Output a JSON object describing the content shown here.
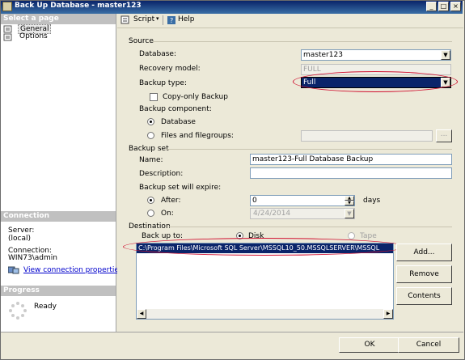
{
  "window": {
    "title": "Back Up Database - master123"
  },
  "sidebar": {
    "select_page_header": "Select a page",
    "pages": [
      "General",
      "Options"
    ],
    "connection_header": "Connection",
    "server_label": "Server:",
    "server_value": "(local)",
    "connection_label": "Connection:",
    "connection_value": "WIN73\\admin",
    "view_connection_link": "View connection properties",
    "progress_header": "Progress",
    "progress_status": "Ready"
  },
  "toolbar": {
    "script_label": "Script",
    "help_label": "Help"
  },
  "source": {
    "header": "Source",
    "database_label": "Database:",
    "database_value": "master123",
    "recovery_label": "Recovery model:",
    "recovery_value": "FULL",
    "backup_type_label": "Backup type:",
    "backup_type_value": "Full",
    "copy_only_label": "Copy-only Backup",
    "component_label": "Backup component:",
    "component_database": "Database",
    "component_files": "Files and filegroups:",
    "files_browse": "..."
  },
  "backup_set": {
    "header": "Backup set",
    "name_label": "Name:",
    "name_value": "master123-Full Database Backup",
    "description_label": "Description:",
    "description_value": "",
    "expire_label": "Backup set will expire:",
    "after_label": "After:",
    "after_value": "0",
    "days_label": "days",
    "on_label": "On:",
    "on_value": "4/24/2014"
  },
  "destination": {
    "header": "Destination",
    "backup_to_label": "Back up to:",
    "disk_label": "Disk",
    "tape_label": "Tape",
    "path": "C:\\Program Files\\Microsoft SQL Server\\MSSQL10_50.MSSQLSERVER\\MSSQL",
    "add_label": "Add...",
    "remove_label": "Remove",
    "contents_label": "Contents"
  },
  "footer": {
    "ok_label": "OK",
    "cancel_label": "Cancel"
  },
  "colors": {
    "title_bar": "#0a246a",
    "highlight": "#0a246a",
    "annotation": "#d01030"
  }
}
